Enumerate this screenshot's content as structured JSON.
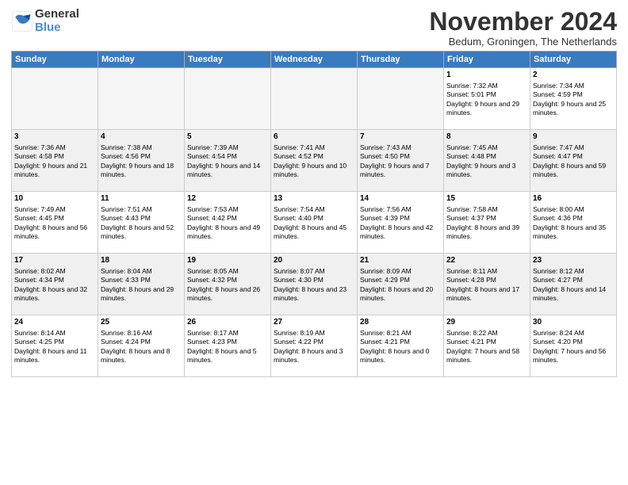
{
  "logo": {
    "general": "General",
    "blue": "Blue"
  },
  "title": "November 2024",
  "subtitle": "Bedum, Groningen, The Netherlands",
  "headers": [
    "Sunday",
    "Monday",
    "Tuesday",
    "Wednesday",
    "Thursday",
    "Friday",
    "Saturday"
  ],
  "weeks": [
    [
      {
        "day": "",
        "info": ""
      },
      {
        "day": "",
        "info": ""
      },
      {
        "day": "",
        "info": ""
      },
      {
        "day": "",
        "info": ""
      },
      {
        "day": "",
        "info": ""
      },
      {
        "day": "1",
        "info": "Sunrise: 7:32 AM\nSunset: 5:01 PM\nDaylight: 9 hours and 29 minutes."
      },
      {
        "day": "2",
        "info": "Sunrise: 7:34 AM\nSunset: 4:59 PM\nDaylight: 9 hours and 25 minutes."
      }
    ],
    [
      {
        "day": "3",
        "info": "Sunrise: 7:36 AM\nSunset: 4:58 PM\nDaylight: 9 hours and 21 minutes."
      },
      {
        "day": "4",
        "info": "Sunrise: 7:38 AM\nSunset: 4:56 PM\nDaylight: 9 hours and 18 minutes."
      },
      {
        "day": "5",
        "info": "Sunrise: 7:39 AM\nSunset: 4:54 PM\nDaylight: 9 hours and 14 minutes."
      },
      {
        "day": "6",
        "info": "Sunrise: 7:41 AM\nSunset: 4:52 PM\nDaylight: 9 hours and 10 minutes."
      },
      {
        "day": "7",
        "info": "Sunrise: 7:43 AM\nSunset: 4:50 PM\nDaylight: 9 hours and 7 minutes."
      },
      {
        "day": "8",
        "info": "Sunrise: 7:45 AM\nSunset: 4:48 PM\nDaylight: 9 hours and 3 minutes."
      },
      {
        "day": "9",
        "info": "Sunrise: 7:47 AM\nSunset: 4:47 PM\nDaylight: 8 hours and 59 minutes."
      }
    ],
    [
      {
        "day": "10",
        "info": "Sunrise: 7:49 AM\nSunset: 4:45 PM\nDaylight: 8 hours and 56 minutes."
      },
      {
        "day": "11",
        "info": "Sunrise: 7:51 AM\nSunset: 4:43 PM\nDaylight: 8 hours and 52 minutes."
      },
      {
        "day": "12",
        "info": "Sunrise: 7:53 AM\nSunset: 4:42 PM\nDaylight: 8 hours and 49 minutes."
      },
      {
        "day": "13",
        "info": "Sunrise: 7:54 AM\nSunset: 4:40 PM\nDaylight: 8 hours and 45 minutes."
      },
      {
        "day": "14",
        "info": "Sunrise: 7:56 AM\nSunset: 4:39 PM\nDaylight: 8 hours and 42 minutes."
      },
      {
        "day": "15",
        "info": "Sunrise: 7:58 AM\nSunset: 4:37 PM\nDaylight: 8 hours and 39 minutes."
      },
      {
        "day": "16",
        "info": "Sunrise: 8:00 AM\nSunset: 4:36 PM\nDaylight: 8 hours and 35 minutes."
      }
    ],
    [
      {
        "day": "17",
        "info": "Sunrise: 8:02 AM\nSunset: 4:34 PM\nDaylight: 8 hours and 32 minutes."
      },
      {
        "day": "18",
        "info": "Sunrise: 8:04 AM\nSunset: 4:33 PM\nDaylight: 8 hours and 29 minutes."
      },
      {
        "day": "19",
        "info": "Sunrise: 8:05 AM\nSunset: 4:32 PM\nDaylight: 8 hours and 26 minutes."
      },
      {
        "day": "20",
        "info": "Sunrise: 8:07 AM\nSunset: 4:30 PM\nDaylight: 8 hours and 23 minutes."
      },
      {
        "day": "21",
        "info": "Sunrise: 8:09 AM\nSunset: 4:29 PM\nDaylight: 8 hours and 20 minutes."
      },
      {
        "day": "22",
        "info": "Sunrise: 8:11 AM\nSunset: 4:28 PM\nDaylight: 8 hours and 17 minutes."
      },
      {
        "day": "23",
        "info": "Sunrise: 8:12 AM\nSunset: 4:27 PM\nDaylight: 8 hours and 14 minutes."
      }
    ],
    [
      {
        "day": "24",
        "info": "Sunrise: 8:14 AM\nSunset: 4:25 PM\nDaylight: 8 hours and 11 minutes."
      },
      {
        "day": "25",
        "info": "Sunrise: 8:16 AM\nSunset: 4:24 PM\nDaylight: 8 hours and 8 minutes."
      },
      {
        "day": "26",
        "info": "Sunrise: 8:17 AM\nSunset: 4:23 PM\nDaylight: 8 hours and 5 minutes."
      },
      {
        "day": "27",
        "info": "Sunrise: 8:19 AM\nSunset: 4:22 PM\nDaylight: 8 hours and 3 minutes."
      },
      {
        "day": "28",
        "info": "Sunrise: 8:21 AM\nSunset: 4:21 PM\nDaylight: 8 hours and 0 minutes."
      },
      {
        "day": "29",
        "info": "Sunrise: 8:22 AM\nSunset: 4:21 PM\nDaylight: 7 hours and 58 minutes."
      },
      {
        "day": "30",
        "info": "Sunrise: 8:24 AM\nSunset: 4:20 PM\nDaylight: 7 hours and 56 minutes."
      }
    ]
  ]
}
